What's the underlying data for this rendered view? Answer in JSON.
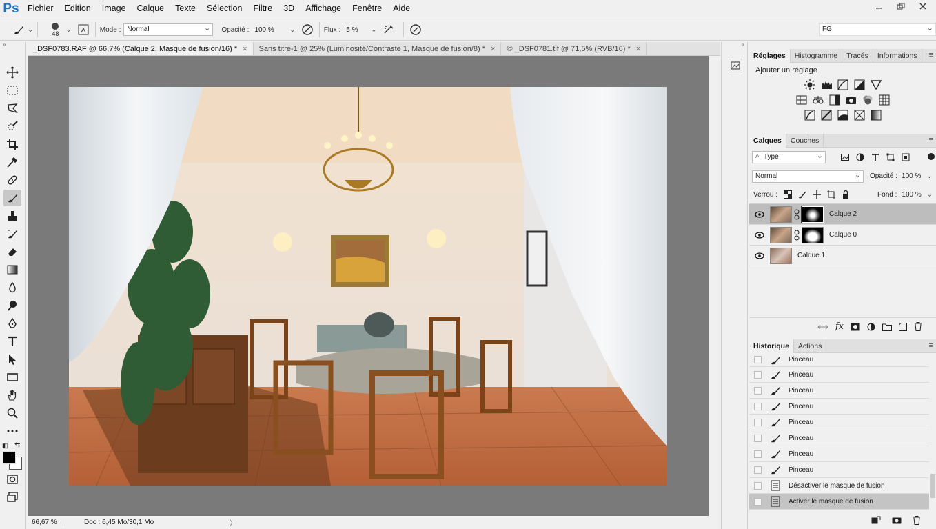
{
  "app": {
    "logo": "Ps"
  },
  "menu": [
    "Fichier",
    "Edition",
    "Image",
    "Calque",
    "Texte",
    "Sélection",
    "Filtre",
    "3D",
    "Affichage",
    "Fenêtre",
    "Aide"
  ],
  "options": {
    "brush_size": "48",
    "mode_label": "Mode :",
    "mode_value": "Normal",
    "opacity_label": "Opacité :",
    "opacity_value": "100 %",
    "flux_label": "Flux :",
    "flux_value": "5 %",
    "workspace_value": "FG"
  },
  "tabs": [
    {
      "label": "_DSF0783.RAF @ 66,7% (Calque 2, Masque de fusion/16) *",
      "active": true
    },
    {
      "label": "Sans titre-1 @ 25% (Luminosité/Contraste 1, Masque de fusion/8) *",
      "active": false
    },
    {
      "label": "© _DSF0781.tif @ 71,5% (RVB/16) *",
      "active": false
    }
  ],
  "tab_close": "×",
  "status": {
    "zoom": "66,67 %",
    "doc": "Doc : 6,45 Mo/30,1 Mo"
  },
  "adjust_panel": {
    "tabs": [
      "Réglages",
      "Histogramme",
      "Tracés",
      "Informations"
    ],
    "title": "Ajouter un réglage"
  },
  "layers_panel": {
    "tabs": [
      "Calques",
      "Couches"
    ],
    "filter_value": "Type",
    "blend_value": "Normal",
    "opacity_label": "Opacité :",
    "opacity_value": "100 %",
    "lock_label": "Verrou :",
    "fill_label": "Fond :",
    "fill_value": "100 %",
    "layers": [
      {
        "name": "Calque 2",
        "selected": true,
        "mask": true
      },
      {
        "name": "Calque 0",
        "selected": false,
        "mask": true
      },
      {
        "name": "Calque 1",
        "selected": false,
        "mask": false
      }
    ]
  },
  "history_panel": {
    "tabs": [
      "Historique",
      "Actions"
    ],
    "items": [
      {
        "label": "Pinceau",
        "icon": "brush-icon"
      },
      {
        "label": "Pinceau",
        "icon": "brush-icon"
      },
      {
        "label": "Pinceau",
        "icon": "brush-icon"
      },
      {
        "label": "Pinceau",
        "icon": "brush-icon"
      },
      {
        "label": "Pinceau",
        "icon": "brush-icon"
      },
      {
        "label": "Pinceau",
        "icon": "brush-icon"
      },
      {
        "label": "Pinceau",
        "icon": "brush-icon"
      },
      {
        "label": "Pinceau",
        "icon": "brush-icon"
      },
      {
        "label": "Désactiver le masque de fusion",
        "icon": "document-icon"
      },
      {
        "label": "Activer le masque de fusion",
        "icon": "document-icon",
        "selected": true
      }
    ]
  },
  "colors": {
    "ps_blue": "#1f6fd0",
    "canvas_bg": "#7a7a7a",
    "selected_row": "#bdbdbd"
  }
}
